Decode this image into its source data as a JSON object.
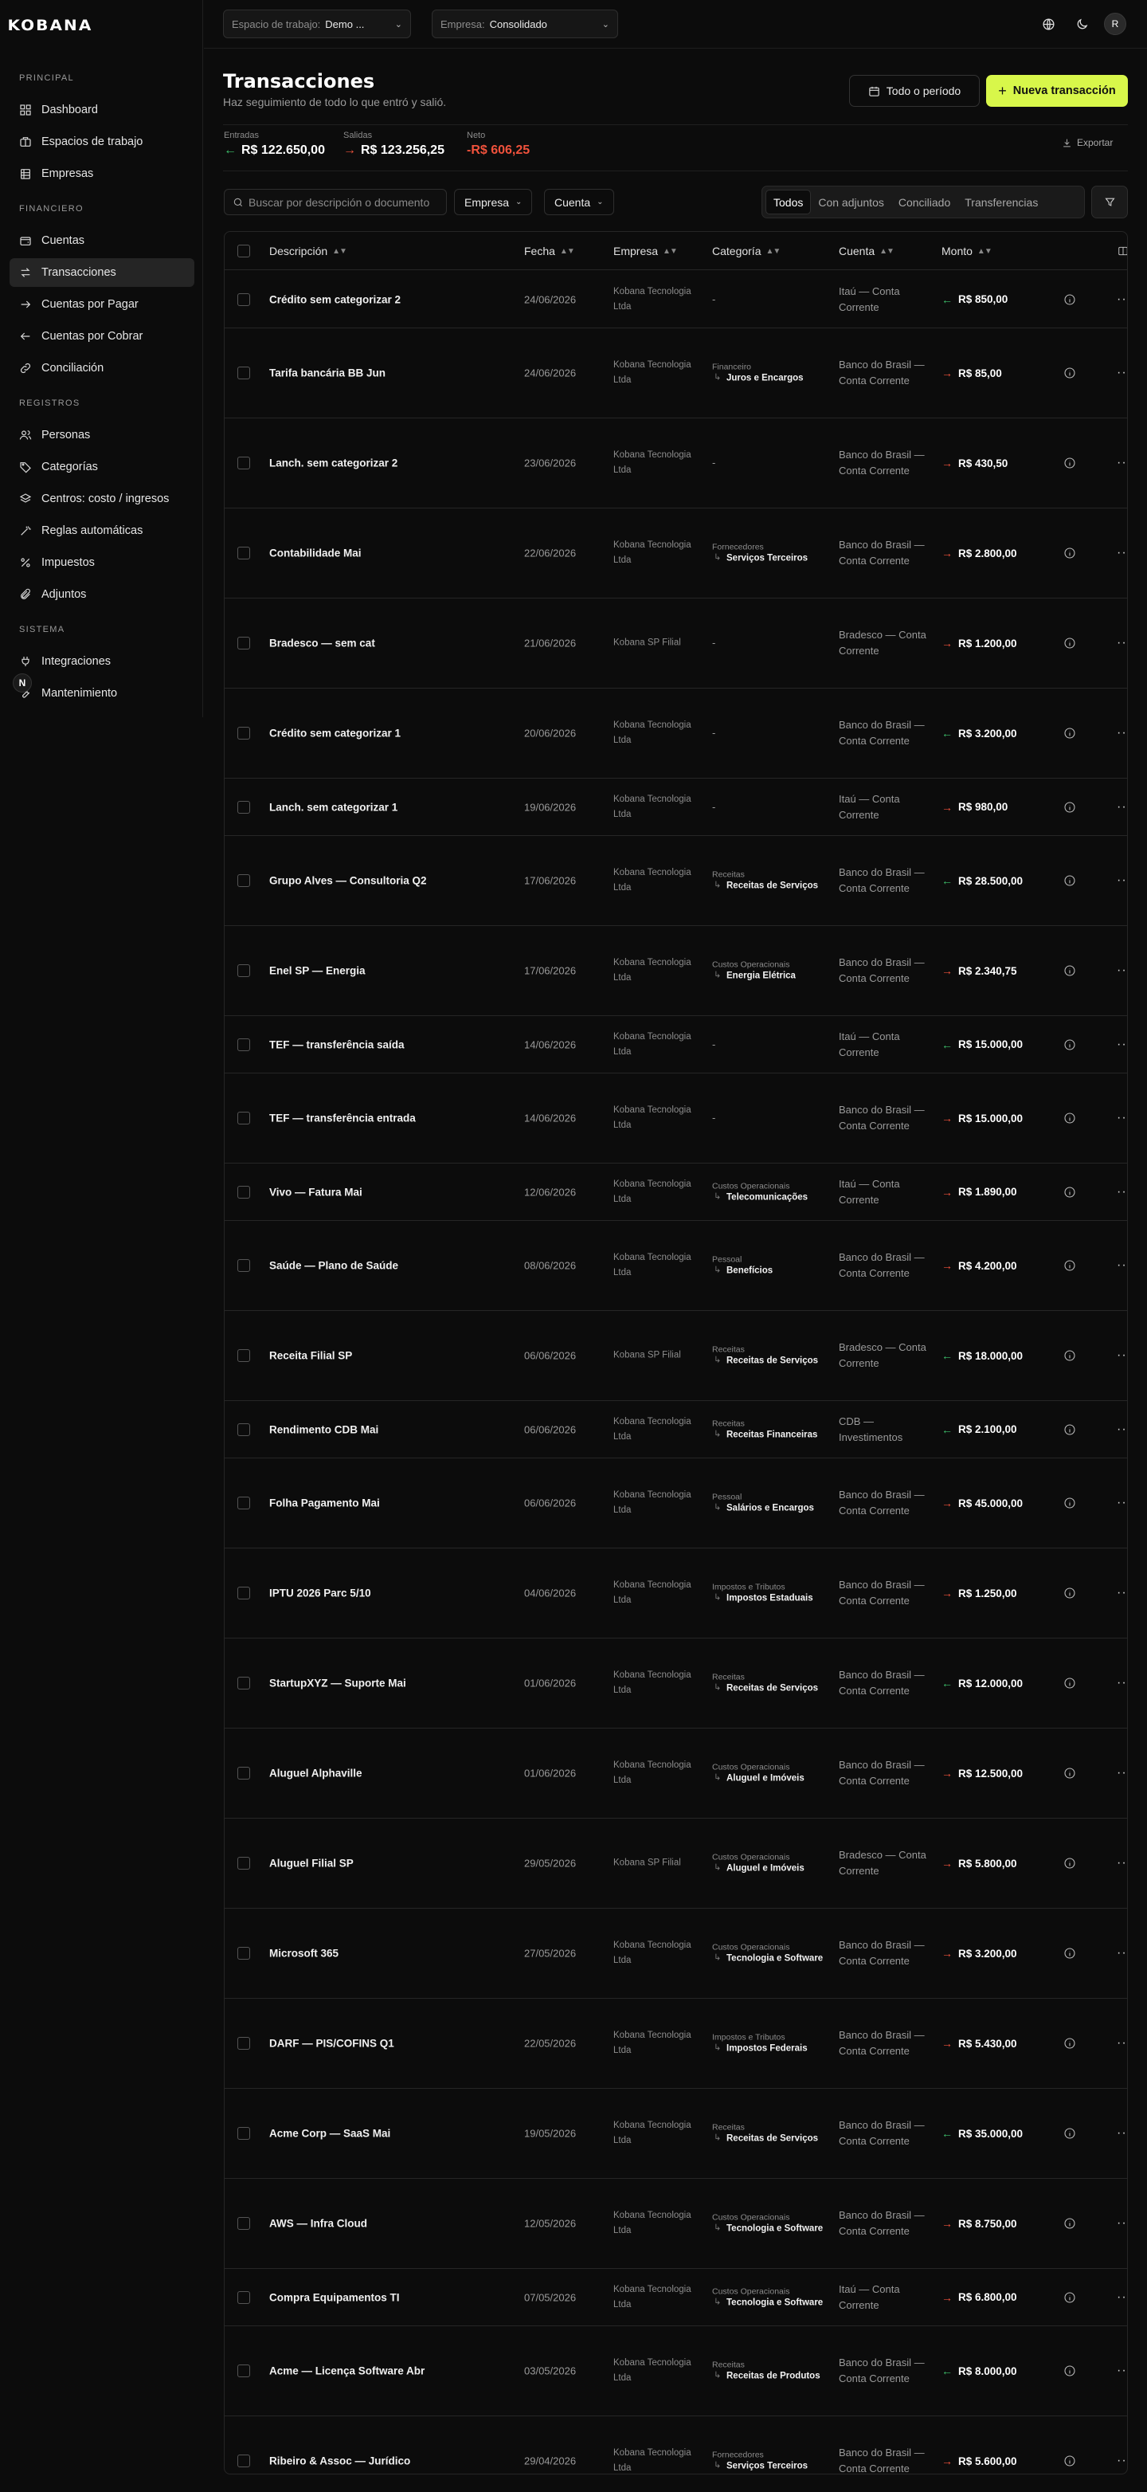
{
  "logo_text": "KOBANA",
  "sidebar": {
    "sections": [
      {
        "label": "Principal",
        "items": [
          {
            "label": "Dashboard",
            "icon": "dashboard-icon"
          },
          {
            "label": "Espacios de trabajo",
            "icon": "workspaces-icon"
          },
          {
            "label": "Empresas",
            "icon": "building-icon"
          }
        ]
      },
      {
        "label": "Financiero",
        "items": [
          {
            "label": "Cuentas",
            "icon": "wallet-icon"
          },
          {
            "label": "Transacciones",
            "icon": "transactions-icon",
            "active": true
          },
          {
            "label": "Cuentas por Pagar",
            "icon": "arrow-right-icon"
          },
          {
            "label": "Cuentas por Cobrar",
            "icon": "arrow-left-icon"
          },
          {
            "label": "Conciliación",
            "icon": "link-icon"
          }
        ]
      },
      {
        "label": "Registros",
        "items": [
          {
            "label": "Personas",
            "icon": "people-icon"
          },
          {
            "label": "Categorías",
            "icon": "tag-icon"
          },
          {
            "label": "Centros: costo / ingresos",
            "icon": "layers-icon"
          },
          {
            "label": "Reglas automáticas",
            "icon": "wand-icon"
          },
          {
            "label": "Impuestos",
            "icon": "percent-icon"
          },
          {
            "label": "Adjuntos",
            "icon": "paperclip-icon"
          }
        ]
      },
      {
        "label": "Sistema",
        "items": [
          {
            "label": "Integraciones",
            "icon": "plug-icon"
          },
          {
            "label": "Mantenimiento",
            "icon": "wrench-icon"
          }
        ]
      }
    ],
    "fab_label": "N"
  },
  "topbar": {
    "workspace_label": "Espacio de trabajo:",
    "workspace_value": "Demo ...",
    "company_label": "Empresa:",
    "company_value": "Consolidado",
    "avatar": "R"
  },
  "header": {
    "title": "Transacciones",
    "subtitle": "Haz seguimiento de todo lo que entró y salió.",
    "period_button": "Todo o período",
    "new_button": "Nueva transacción"
  },
  "stats": {
    "in_label": "Entradas",
    "in_value": "R$ 122.650,00",
    "out_label": "Salidas",
    "out_value": "R$ 123.256,25",
    "net_label": "Neto",
    "net_value": "-R$ 606,25",
    "net_color": "#f0523c",
    "export": "Exportar"
  },
  "filters": {
    "search_placeholder": "Buscar por descripción o documento",
    "company_filter": "Empresa",
    "account_filter": "Cuenta",
    "segments": [
      "Todos",
      "Con adjuntos",
      "Conciliado",
      "Transferencias"
    ],
    "active_segment": "Todos"
  },
  "table": {
    "columns": [
      "Descripción",
      "Fecha",
      "Empresa",
      "Categoría",
      "Cuenta",
      "Monto"
    ],
    "rows": [
      {
        "desc": "Crédito sem categorizar 2",
        "date": "24/06/2026",
        "emp": "Kobana Tecnologia Ltda",
        "cat_parent": "",
        "cat": "",
        "acc": "Itaú — Conta Corrente",
        "dir": "in",
        "amt": "R$ 850,00"
      },
      {
        "desc": "Tarifa bancária BB Jun",
        "date": "24/06/2026",
        "emp": "Kobana Tecnologia Ltda",
        "cat_parent": "Financeiro",
        "cat": "Juros e Encargos",
        "acc": "Banco do Brasil — Conta Corrente",
        "dir": "out",
        "amt": "R$ 85,00"
      },
      {
        "desc": "Lanch. sem categorizar 2",
        "date": "23/06/2026",
        "emp": "Kobana Tecnologia Ltda",
        "cat_parent": "",
        "cat": "",
        "acc": "Banco do Brasil — Conta Corrente",
        "dir": "out",
        "amt": "R$ 430,50"
      },
      {
        "desc": "Contabilidade Mai",
        "date": "22/06/2026",
        "emp": "Kobana Tecnologia Ltda",
        "cat_parent": "Fornecedores",
        "cat": "Serviços Terceiros",
        "acc": "Banco do Brasil — Conta Corrente",
        "dir": "out",
        "amt": "R$ 2.800,00"
      },
      {
        "desc": "Bradesco — sem cat",
        "date": "21/06/2026",
        "emp": "Kobana SP Filial",
        "cat_parent": "",
        "cat": "",
        "acc": "Bradesco — Conta Corrente",
        "dir": "out",
        "amt": "R$ 1.200,00"
      },
      {
        "desc": "Crédito sem categorizar 1",
        "date": "20/06/2026",
        "emp": "Kobana Tecnologia Ltda",
        "cat_parent": "",
        "cat": "",
        "acc": "Banco do Brasil — Conta Corrente",
        "dir": "in",
        "amt": "R$ 3.200,00"
      },
      {
        "desc": "Lanch. sem categorizar 1",
        "date": "19/06/2026",
        "emp": "Kobana Tecnologia Ltda",
        "cat_parent": "",
        "cat": "",
        "acc": "Itaú — Conta Corrente",
        "dir": "out",
        "amt": "R$ 980,00"
      },
      {
        "desc": "Grupo Alves — Consultoria Q2",
        "date": "17/06/2026",
        "emp": "Kobana Tecnologia Ltda",
        "cat_parent": "Receitas",
        "cat": "Receitas de Serviços",
        "acc": "Banco do Brasil — Conta Corrente",
        "dir": "in",
        "amt": "R$ 28.500,00"
      },
      {
        "desc": "Enel SP — Energia",
        "date": "17/06/2026",
        "emp": "Kobana Tecnologia Ltda",
        "cat_parent": "Custos Operacionais",
        "cat": "Energia Elétrica",
        "acc": "Banco do Brasil — Conta Corrente",
        "dir": "out",
        "amt": "R$ 2.340,75"
      },
      {
        "desc": "TEF — transferência saída",
        "date": "14/06/2026",
        "emp": "Kobana Tecnologia Ltda",
        "cat_parent": "",
        "cat": "",
        "acc": "Itaú — Conta Corrente",
        "dir": "in",
        "amt": "R$ 15.000,00"
      },
      {
        "desc": "TEF — transferência entrada",
        "date": "14/06/2026",
        "emp": "Kobana Tecnologia Ltda",
        "cat_parent": "",
        "cat": "",
        "acc": "Banco do Brasil — Conta Corrente",
        "dir": "out",
        "amt": "R$ 15.000,00"
      },
      {
        "desc": "Vivo — Fatura Mai",
        "date": "12/06/2026",
        "emp": "Kobana Tecnologia Ltda",
        "cat_parent": "Custos Operacionais",
        "cat": "Telecomunicações",
        "acc": "Itaú — Conta Corrente",
        "dir": "out",
        "amt": "R$ 1.890,00"
      },
      {
        "desc": "Saúde — Plano de Saúde",
        "date": "08/06/2026",
        "emp": "Kobana Tecnologia Ltda",
        "cat_parent": "Pessoal",
        "cat": "Benefícios",
        "acc": "Banco do Brasil — Conta Corrente",
        "dir": "out",
        "amt": "R$ 4.200,00"
      },
      {
        "desc": "Receita Filial SP",
        "date": "06/06/2026",
        "emp": "Kobana SP Filial",
        "cat_parent": "Receitas",
        "cat": "Receitas de Serviços",
        "acc": "Bradesco — Conta Corrente",
        "dir": "in",
        "amt": "R$ 18.000,00"
      },
      {
        "desc": "Rendimento CDB Mai",
        "date": "06/06/2026",
        "emp": "Kobana Tecnologia Ltda",
        "cat_parent": "Receitas",
        "cat": "Receitas Financeiras",
        "acc": "CDB — Investimentos",
        "dir": "in",
        "amt": "R$ 2.100,00"
      },
      {
        "desc": "Folha Pagamento Mai",
        "date": "06/06/2026",
        "emp": "Kobana Tecnologia Ltda",
        "cat_parent": "Pessoal",
        "cat": "Salários e Encargos",
        "acc": "Banco do Brasil — Conta Corrente",
        "dir": "out",
        "amt": "R$ 45.000,00"
      },
      {
        "desc": "IPTU 2026 Parc 5/10",
        "date": "04/06/2026",
        "emp": "Kobana Tecnologia Ltda",
        "cat_parent": "Impostos e Tributos",
        "cat": "Impostos Estaduais",
        "acc": "Banco do Brasil — Conta Corrente",
        "dir": "out",
        "amt": "R$ 1.250,00"
      },
      {
        "desc": "StartupXYZ — Suporte Mai",
        "date": "01/06/2026",
        "emp": "Kobana Tecnologia Ltda",
        "cat_parent": "Receitas",
        "cat": "Receitas de Serviços",
        "acc": "Banco do Brasil — Conta Corrente",
        "dir": "in",
        "amt": "R$ 12.000,00"
      },
      {
        "desc": "Aluguel Alphaville",
        "date": "01/06/2026",
        "emp": "Kobana Tecnologia Ltda",
        "cat_parent": "Custos Operacionais",
        "cat": "Aluguel e Imóveis",
        "acc": "Banco do Brasil — Conta Corrente",
        "dir": "out",
        "amt": "R$ 12.500,00"
      },
      {
        "desc": "Aluguel Filial SP",
        "date": "29/05/2026",
        "emp": "Kobana SP Filial",
        "cat_parent": "Custos Operacionais",
        "cat": "Aluguel e Imóveis",
        "acc": "Bradesco — Conta Corrente",
        "dir": "out",
        "amt": "R$ 5.800,00"
      },
      {
        "desc": "Microsoft 365",
        "date": "27/05/2026",
        "emp": "Kobana Tecnologia Ltda",
        "cat_parent": "Custos Operacionais",
        "cat": "Tecnologia e Software",
        "acc": "Banco do Brasil — Conta Corrente",
        "dir": "out",
        "amt": "R$ 3.200,00"
      },
      {
        "desc": "DARF — PIS/COFINS Q1",
        "date": "22/05/2026",
        "emp": "Kobana Tecnologia Ltda",
        "cat_parent": "Impostos e Tributos",
        "cat": "Impostos Federais",
        "acc": "Banco do Brasil — Conta Corrente",
        "dir": "out",
        "amt": "R$ 5.430,00"
      },
      {
        "desc": "Acme Corp — SaaS Mai",
        "date": "19/05/2026",
        "emp": "Kobana Tecnologia Ltda",
        "cat_parent": "Receitas",
        "cat": "Receitas de Serviços",
        "acc": "Banco do Brasil — Conta Corrente",
        "dir": "in",
        "amt": "R$ 35.000,00"
      },
      {
        "desc": "AWS — Infra Cloud",
        "date": "12/05/2026",
        "emp": "Kobana Tecnologia Ltda",
        "cat_parent": "Custos Operacionais",
        "cat": "Tecnologia e Software",
        "acc": "Banco do Brasil — Conta Corrente",
        "dir": "out",
        "amt": "R$ 8.750,00"
      },
      {
        "desc": "Compra Equipamentos TI",
        "date": "07/05/2026",
        "emp": "Kobana Tecnologia Ltda",
        "cat_parent": "Custos Operacionais",
        "cat": "Tecnologia e Software",
        "acc": "Itaú — Conta Corrente",
        "dir": "out",
        "amt": "R$ 6.800,00"
      },
      {
        "desc": "Acme — Licença Software Abr",
        "date": "03/05/2026",
        "emp": "Kobana Tecnologia Ltda",
        "cat_parent": "Receitas",
        "cat": "Receitas de Produtos",
        "acc": "Banco do Brasil — Conta Corrente",
        "dir": "in",
        "amt": "R$ 8.000,00"
      },
      {
        "desc": "Ribeiro & Assoc — Jurídico",
        "date": "29/04/2026",
        "emp": "Kobana Tecnologia Ltda",
        "cat_parent": "Fornecedores",
        "cat": "Serviços Terceiros",
        "acc": "Banco do Brasil — Conta Corrente",
        "dir": "out",
        "amt": "R$ 5.600,00"
      }
    ]
  }
}
